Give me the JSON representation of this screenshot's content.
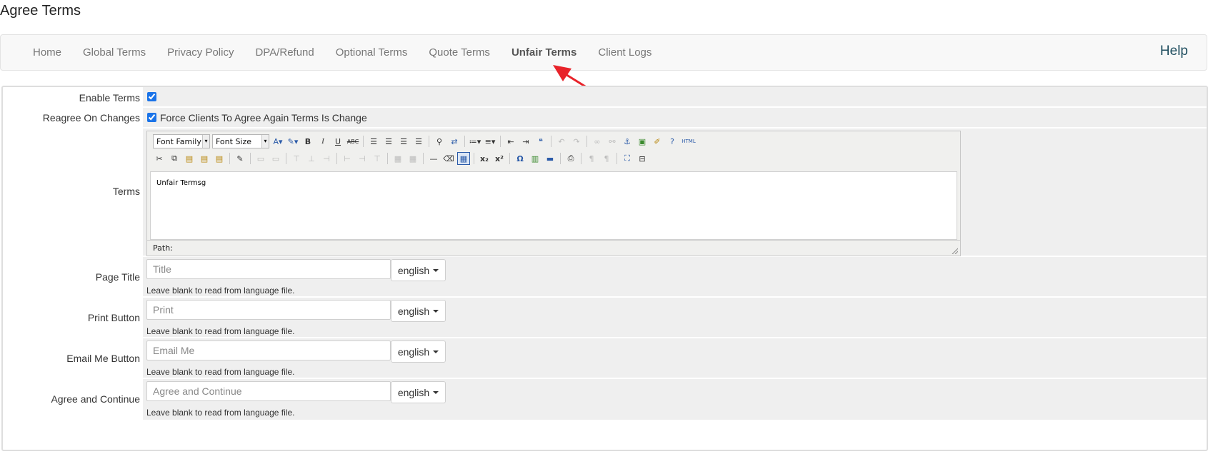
{
  "page_title": "Agree Terms",
  "nav": {
    "tabs": [
      {
        "label": "Home"
      },
      {
        "label": "Global Terms"
      },
      {
        "label": "Privacy Policy"
      },
      {
        "label": "DPA/Refund"
      },
      {
        "label": "Optional Terms"
      },
      {
        "label": "Quote Terms"
      },
      {
        "label": "Unfair Terms",
        "active": true
      },
      {
        "label": "Client Logs"
      }
    ],
    "help_label": "Help"
  },
  "form": {
    "enable_terms": {
      "label": "Enable Terms",
      "checked": true
    },
    "reagree": {
      "label": "Reagree On Changes",
      "checked": true,
      "option_label": "Force Clients To Agree Again Terms Is Change"
    },
    "terms": {
      "label": "Terms",
      "toolbar": {
        "font_family": "Font Family",
        "font_size": "Font Size"
      },
      "content": "Unfair Termsg",
      "path_label": "Path:"
    },
    "fields": [
      {
        "label": "Page Title",
        "placeholder": "Title",
        "language": "english",
        "help": "Leave blank to read from language file."
      },
      {
        "label": "Print Button",
        "placeholder": "Print",
        "language": "english",
        "help": "Leave blank to read from language file."
      },
      {
        "label": "Email Me Button",
        "placeholder": "Email Me",
        "language": "english",
        "help": "Leave blank to read from language file."
      },
      {
        "label": "Agree and Continue",
        "placeholder": "Agree and Continue",
        "language": "english",
        "help": "Leave blank to read from language file."
      }
    ]
  },
  "colors": {
    "accent_arrow": "#e8232a",
    "help_link": "#1f4e5f",
    "row_bg": "#efefef"
  }
}
